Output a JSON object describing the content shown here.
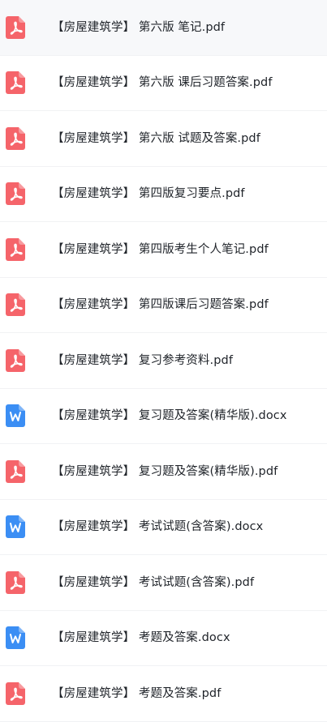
{
  "files": [
    {
      "name": "【房屋建筑学】  第六版 笔记.pdf",
      "icon": "pdf-icon",
      "type": "pdf",
      "selected": true
    },
    {
      "name": "【房屋建筑学】  第六版 课后习题答案.pdf",
      "icon": "pdf-icon",
      "type": "pdf"
    },
    {
      "name": "【房屋建筑学】  第六版 试题及答案.pdf",
      "icon": "pdf-icon",
      "type": "pdf"
    },
    {
      "name": "【房屋建筑学】 第四版复习要点.pdf",
      "icon": "pdf-icon",
      "type": "pdf"
    },
    {
      "name": "【房屋建筑学】 第四版考生个人笔记.pdf",
      "icon": "pdf-icon",
      "type": "pdf"
    },
    {
      "name": "【房屋建筑学】 第四版课后习题答案.pdf",
      "icon": "pdf-icon",
      "type": "pdf"
    },
    {
      "name": "【房屋建筑学】 复习参考资料.pdf",
      "icon": "pdf-icon",
      "type": "pdf"
    },
    {
      "name": "【房屋建筑学】 复习题及答案(精华版).docx",
      "icon": "word-icon",
      "type": "docx"
    },
    {
      "name": "【房屋建筑学】 复习题及答案(精华版).pdf",
      "icon": "pdf-icon",
      "type": "pdf"
    },
    {
      "name": "【房屋建筑学】 考试试题(含答案).docx",
      "icon": "word-icon",
      "type": "docx"
    },
    {
      "name": "【房屋建筑学】 考试试题(含答案).pdf",
      "icon": "pdf-icon",
      "type": "pdf"
    },
    {
      "name": "【房屋建筑学】 考题及答案.docx",
      "icon": "word-icon",
      "type": "docx"
    },
    {
      "name": "【房屋建筑学】 考题及答案.pdf",
      "icon": "pdf-icon",
      "type": "pdf"
    }
  ],
  "colors": {
    "pdf": "#f5646a",
    "word": "#3b8ef4",
    "row_selected": "#f7f8fa",
    "text": "#1f2329"
  }
}
